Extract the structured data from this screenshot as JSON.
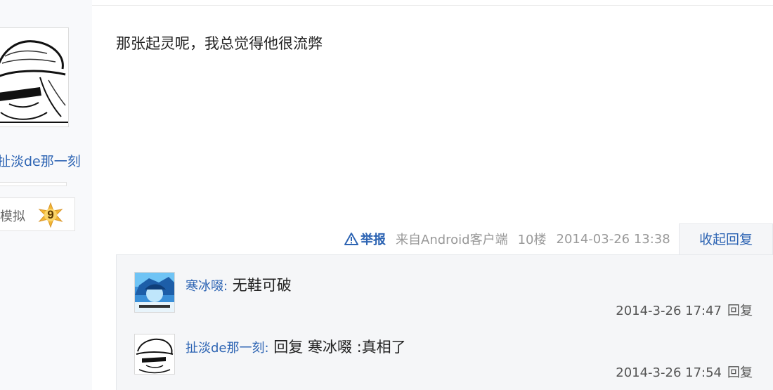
{
  "author": {
    "name": "扯淡de那一刻",
    "level_name": "模拟",
    "level": "9"
  },
  "post": {
    "content": "那张起灵呢，我总觉得他很流弊",
    "report_label": "举报",
    "source": "来自Android客户端",
    "floor": "10楼",
    "time": "2014-03-26 13:38",
    "collapse_label": "收起回复"
  },
  "replies": [
    {
      "user": "寒冰啜",
      "separator": ":",
      "text": " 无鞋可破",
      "time": "2014-3-26 17:47",
      "reply_label": "回复",
      "avatar_icon": "anime-avatar-icon"
    },
    {
      "user": "扯淡de那一刻",
      "separator": ":",
      "text": " 回复 寒冰啜 :真相了",
      "time": "2014-3-26 17:54",
      "reply_label": "回复",
      "avatar_icon": "straw-hat-avatar-icon"
    }
  ],
  "colors": {
    "link": "#2d64b3",
    "muted": "#999999",
    "reply_bg": "#f5f6f8",
    "sidebar_bg": "#f8f9fb"
  }
}
